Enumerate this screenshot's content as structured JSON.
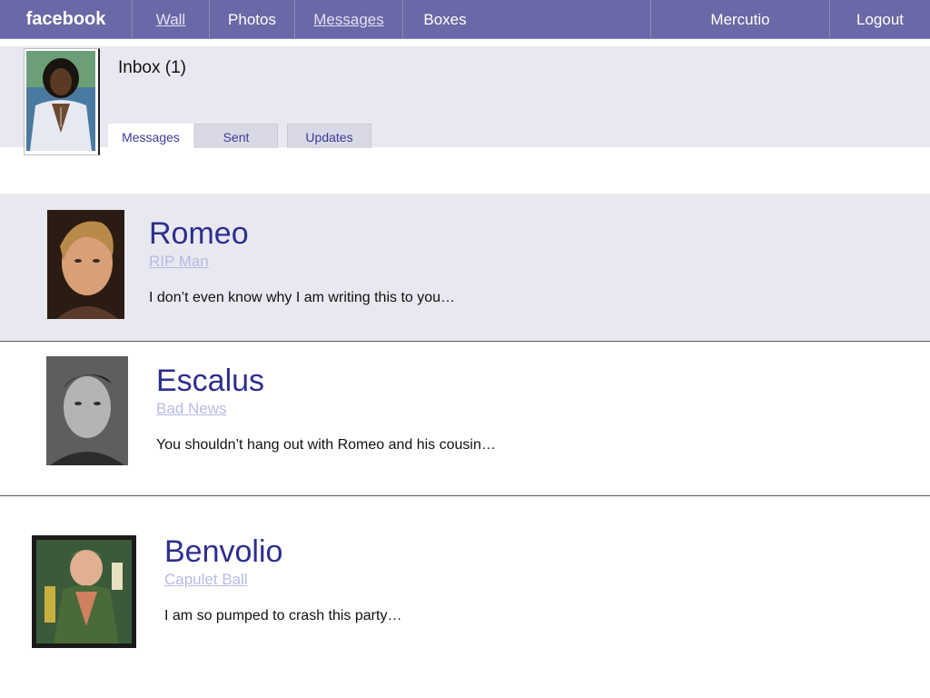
{
  "nav": {
    "brand": "facebook",
    "wall": "Wall",
    "photos": "Photos",
    "messages": "Messages",
    "boxes": "Boxes",
    "user": "Mercutio",
    "logout": "Logout"
  },
  "colors": {
    "nav_bg": "#6a68a6",
    "panel_bg": "#e8e8f0",
    "name_color": "#2e2e8e",
    "subject_color": "#b9b9e6"
  },
  "inbox": {
    "title": "Inbox (1)",
    "tabs": [
      "Messages",
      "Sent",
      "Updates"
    ],
    "active_tab": "Messages"
  },
  "messages": [
    {
      "sender": "Romeo",
      "subject": "RIP Man",
      "preview": "I don’t even know why I am writing this to you…",
      "unread": true
    },
    {
      "sender": "Escalus",
      "subject": "Bad News",
      "preview": "You shouldn’t hang out with Romeo and his cousin…",
      "unread": false
    },
    {
      "sender": "Benvolio",
      "subject": "Capulet Ball",
      "preview": "I am so pumped to crash this party…",
      "unread": false
    }
  ]
}
